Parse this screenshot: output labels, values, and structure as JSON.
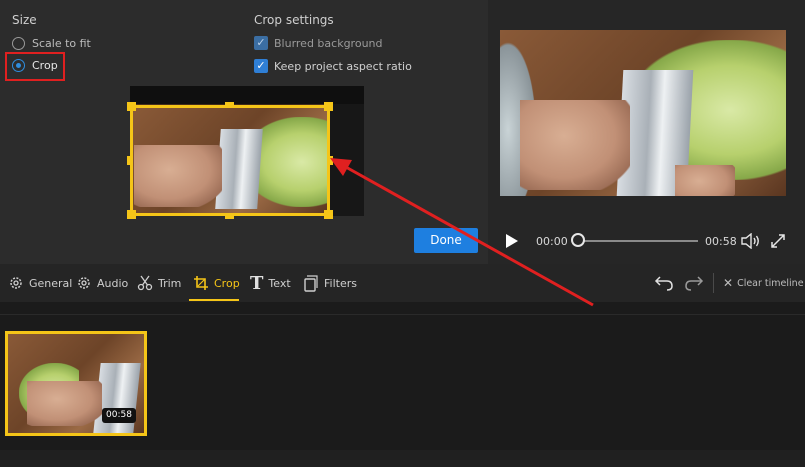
{
  "size": {
    "heading": "Size",
    "options": [
      {
        "label": "Scale to fit",
        "selected": false
      },
      {
        "label": "Crop",
        "selected": true
      }
    ]
  },
  "crop_settings": {
    "heading": "Crop settings",
    "options": [
      {
        "label": "Blurred background",
        "checked": true,
        "enabled": false
      },
      {
        "label": "Keep project aspect ratio",
        "checked": true,
        "enabled": true
      }
    ]
  },
  "done_label": "Done",
  "player": {
    "current_time": "00:00",
    "duration": "00:58",
    "progress": 0.0
  },
  "toolbar": {
    "tabs": [
      {
        "label": "General",
        "icon": "gear-icon",
        "active": false
      },
      {
        "label": "Audio",
        "icon": "gear-icon",
        "active": false
      },
      {
        "label": "Trim",
        "icon": "scissors-icon",
        "active": false
      },
      {
        "label": "Crop",
        "icon": "crop-icon",
        "active": true
      },
      {
        "label": "Text",
        "icon": "text-icon",
        "active": false
      },
      {
        "label": "Filters",
        "icon": "filters-icon",
        "active": false
      }
    ],
    "clear_timeline_label": "Clear timeline"
  },
  "timeline": {
    "clip_duration": "00:58"
  },
  "colors": {
    "accent_yellow": "#f5c518",
    "accent_blue": "#1e7fe0",
    "highlight_red": "#e02020"
  }
}
